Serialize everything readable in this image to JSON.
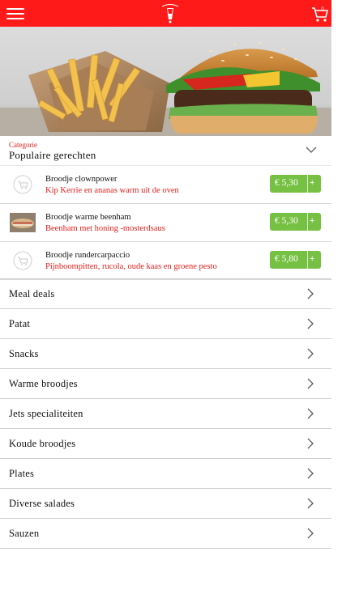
{
  "header": {
    "cart_count": "0"
  },
  "category": {
    "label": "Categorie",
    "title": "Populaire gerechten"
  },
  "popular_items": [
    {
      "name": "Broodje clownpower",
      "description": "Kip Kerrie en ananas  warm uit de oven",
      "price": "€ 5,30",
      "add": "+",
      "has_photo": false
    },
    {
      "name": "Broodje warme beenham",
      "description": "Beenham met honing -mosterdsaus",
      "price": "€ 5,30",
      "add": "+",
      "has_photo": true
    },
    {
      "name": "Broodje rundercarpaccio",
      "description": "Pijnboompitten, rucola, oude kaas en groene pesto",
      "price": "€ 5,80",
      "add": "+",
      "has_photo": false
    }
  ],
  "categories": [
    "Meal deals",
    "Patat",
    "Snacks",
    "Warme broodjes",
    "Jets specialiteiten",
    "Koude broodjes",
    "Plates",
    "Diverse salades",
    "Sauzen"
  ],
  "colors": {
    "header_red": "#ff1a1a",
    "accent_red": "#e0201c",
    "price_green": "#76c043"
  }
}
